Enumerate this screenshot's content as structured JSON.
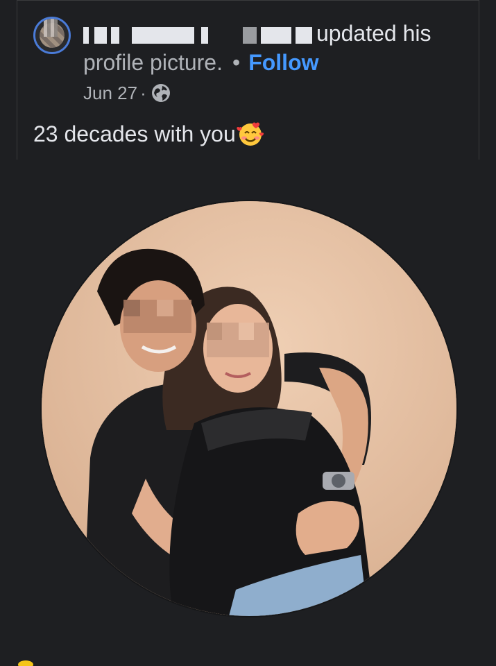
{
  "post": {
    "author_suffix": "updated his",
    "action_line": "profile picture.",
    "separator": "•",
    "follow_label": "Follow",
    "date": "Jun 27",
    "date_separator": "·",
    "privacy_icon": "globe-icon",
    "caption": "23 decades with you",
    "caption_emoji": "smiling-face-with-hearts-emoji"
  },
  "colors": {
    "background": "#1e1f22",
    "text_primary": "#e4e6eb",
    "text_secondary": "#b0b3b8",
    "follow_blue": "#4599ff",
    "avatar_ring": "#4a7bd8",
    "photo_backdrop": "#e2bfa2"
  },
  "photo": {
    "shape": "circle",
    "subject_icon": "couple-photo"
  }
}
